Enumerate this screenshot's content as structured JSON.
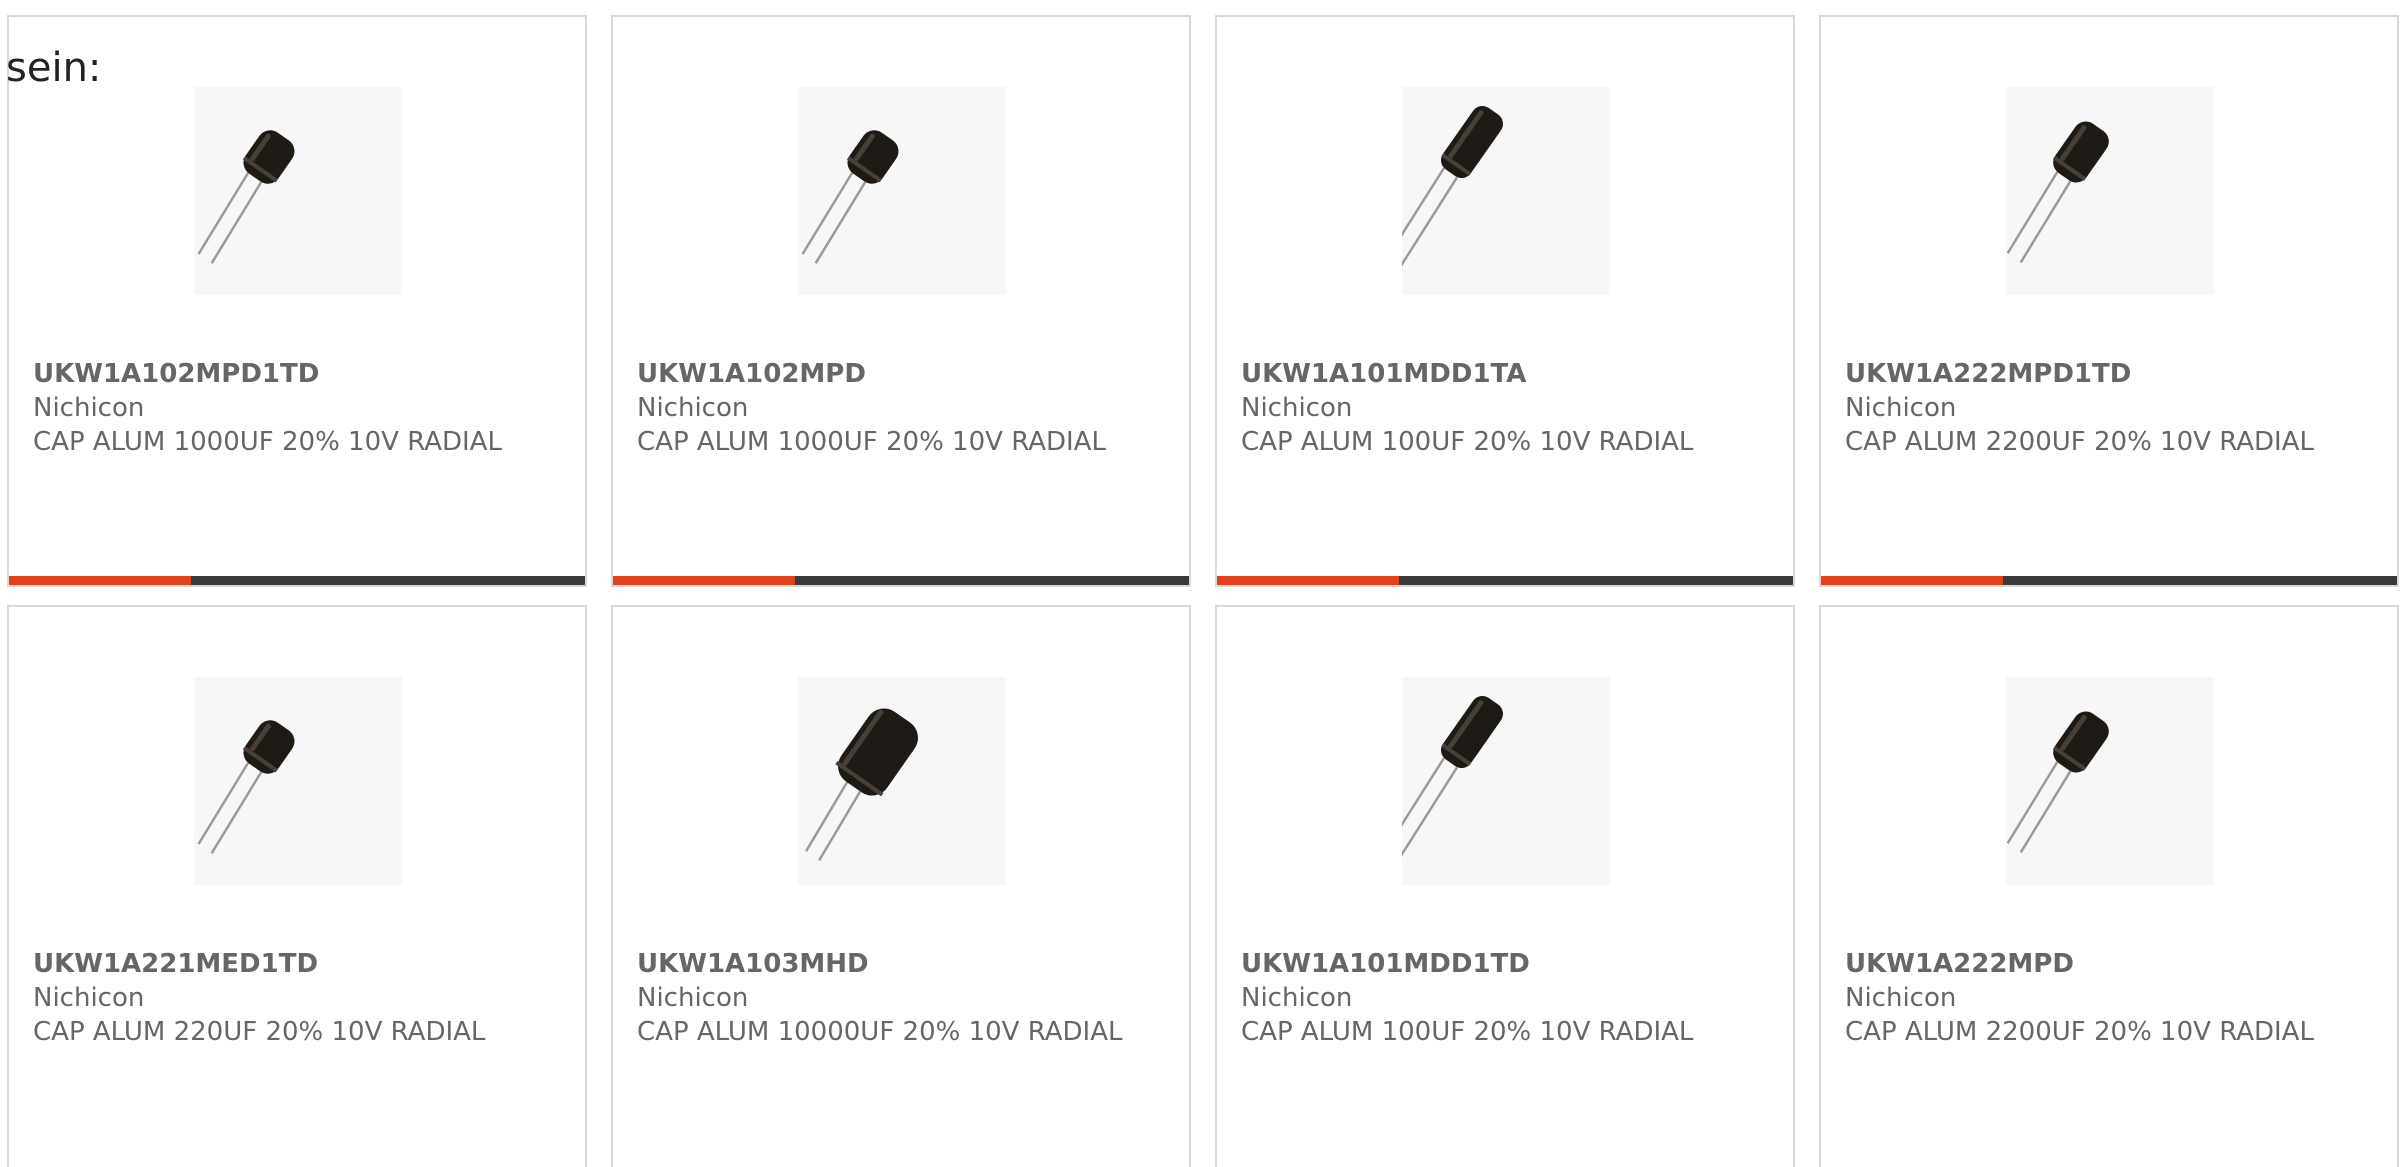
{
  "intro_text": "sein:",
  "colors": {
    "accent": "#e2421a",
    "bar": "#3a3a3a",
    "border": "#d9d9d9",
    "text": "#666666"
  },
  "products": [
    {
      "part_number": "UKW1A102MPD1TD",
      "manufacturer": "Nichicon",
      "description": "CAP ALUM 1000UF 20% 10V RADIAL",
      "image_icon": "capacitor-short-image",
      "has_bar": true
    },
    {
      "part_number": "UKW1A102MPD",
      "manufacturer": "Nichicon",
      "description": "CAP ALUM 1000UF 20% 10V RADIAL",
      "image_icon": "capacitor-short-image",
      "has_bar": true
    },
    {
      "part_number": "UKW1A101MDD1TA",
      "manufacturer": "Nichicon",
      "description": "CAP ALUM 100UF 20% 10V RADIAL",
      "image_icon": "capacitor-tall-image",
      "has_bar": true
    },
    {
      "part_number": "UKW1A222MPD1TD",
      "manufacturer": "Nichicon",
      "description": "CAP ALUM 2200UF 20% 10V RADIAL",
      "image_icon": "capacitor-medium-image",
      "has_bar": true
    },
    {
      "part_number": "UKW1A221MED1TD",
      "manufacturer": "Nichicon",
      "description": "CAP ALUM 220UF 20% 10V RADIAL",
      "image_icon": "capacitor-short-image",
      "has_bar": false
    },
    {
      "part_number": "UKW1A103MHD",
      "manufacturer": "Nichicon",
      "description": "CAP ALUM 10000UF 20% 10V RADIAL",
      "image_icon": "capacitor-large-image",
      "has_bar": false
    },
    {
      "part_number": "UKW1A101MDD1TD",
      "manufacturer": "Nichicon",
      "description": "CAP ALUM 100UF 20% 10V RADIAL",
      "image_icon": "capacitor-tall-image",
      "has_bar": false
    },
    {
      "part_number": "UKW1A222MPD",
      "manufacturer": "Nichicon",
      "description": "CAP ALUM 2200UF 20% 10V RADIAL",
      "image_icon": "capacitor-medium-image",
      "has_bar": false
    }
  ]
}
